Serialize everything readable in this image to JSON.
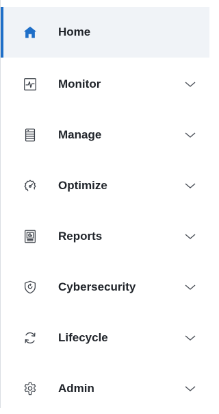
{
  "sidebar": {
    "accent_color": "#1f6fc8",
    "items": [
      {
        "label": "Home",
        "icon": "home-icon",
        "active": true,
        "expandable": false
      },
      {
        "label": "Monitor",
        "icon": "monitor-pulse-icon",
        "active": false,
        "expandable": true
      },
      {
        "label": "Manage",
        "icon": "server-icon",
        "active": false,
        "expandable": true
      },
      {
        "label": "Optimize",
        "icon": "gauge-icon",
        "active": false,
        "expandable": true
      },
      {
        "label": "Reports",
        "icon": "report-icon",
        "active": false,
        "expandable": true
      },
      {
        "label": "Cybersecurity",
        "icon": "shield-icon",
        "active": false,
        "expandable": true
      },
      {
        "label": "Lifecycle",
        "icon": "refresh-icon",
        "active": false,
        "expandable": true
      },
      {
        "label": "Admin",
        "icon": "gear-icon",
        "active": false,
        "expandable": true
      }
    ]
  }
}
